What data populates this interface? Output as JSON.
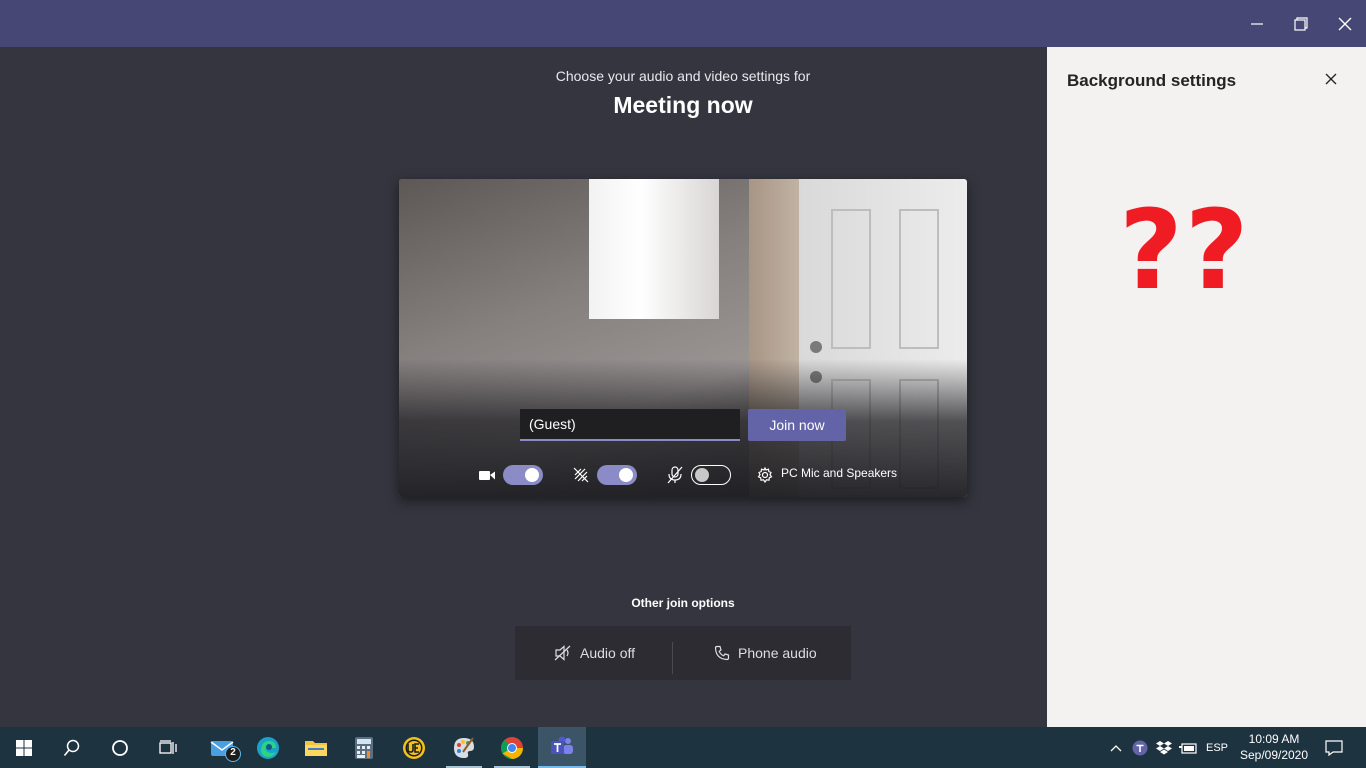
{
  "main": {
    "subtitle": "Choose your audio and video settings for",
    "meeting_title": "Meeting now",
    "name_input_value": "(Guest)",
    "join_label": "Join now",
    "camera_on": true,
    "blur_on": true,
    "mic_on": false,
    "device_label": "PC Mic and Speakers",
    "other_options_label": "Other join options",
    "audio_off_label": "Audio off",
    "phone_audio_label": "Phone audio"
  },
  "side_panel": {
    "title": "Background settings",
    "annotation": "??",
    "annotation_color": "#ef1c24"
  },
  "taskbar": {
    "mail_badge": "2",
    "language": "ESP",
    "time": "10:09 AM",
    "date": "Sep/09/2020"
  },
  "colors": {
    "titlebar": "#464775",
    "accent": "#6264a7",
    "toggle_on": "#8b8cc7",
    "main_bg": "#35353f",
    "taskbar": "#1e3340"
  }
}
